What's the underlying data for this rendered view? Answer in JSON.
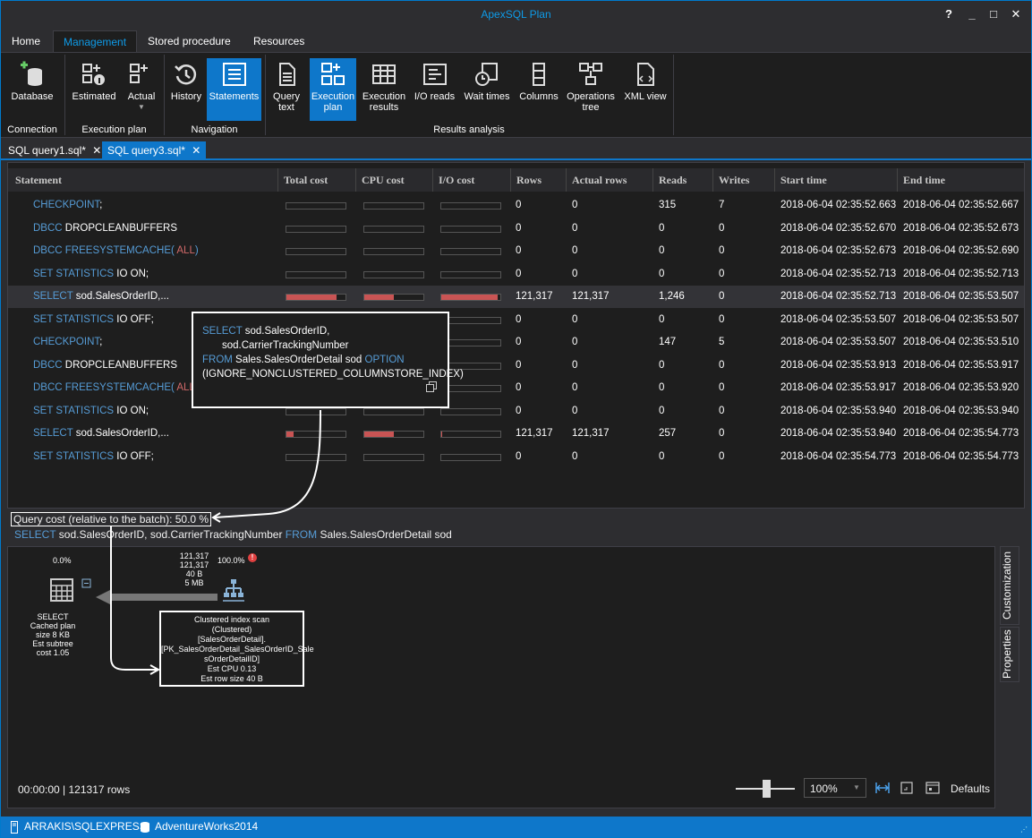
{
  "window": {
    "title": "ApexSQL Plan",
    "help": "?",
    "minimize": "_",
    "maximize": "□",
    "close": "✕"
  },
  "menu": [
    "Home",
    "Management",
    "Stored procedure",
    "Resources"
  ],
  "ribbon": {
    "connection": {
      "group": "Connection",
      "database": "Database"
    },
    "execution_plan": {
      "group": "Execution plan",
      "estimated": "Estimated",
      "actual": "Actual"
    },
    "navigation": {
      "group": "Navigation",
      "history": "History",
      "statements": "Statements"
    },
    "results": {
      "group": "Results analysis",
      "query_text": [
        "Query",
        "text"
      ],
      "execution_plan": [
        "Execution",
        "plan"
      ],
      "execution_results": [
        "Execution",
        "results"
      ],
      "io_reads": "I/O reads",
      "wait_times": "Wait times",
      "columns": "Columns",
      "operations_tree": [
        "Operations",
        "tree"
      ],
      "xml_view": "XML view"
    }
  },
  "doc_tabs": [
    {
      "label": "SQL query1.sql*",
      "close": "✕"
    },
    {
      "label": "SQL query3.sql*",
      "close": "✕"
    }
  ],
  "grid": {
    "headers": [
      "Statement",
      "Total cost",
      "CPU cost",
      "I/O cost",
      "Rows",
      "Actual rows",
      "Reads",
      "Writes",
      "Start time",
      "End time"
    ],
    "rows": [
      {
        "s1": "CHECKPOINT",
        "s2": ";",
        "s3": "",
        "s4": "",
        "tc": 0,
        "cc": 0,
        "ic": 0,
        "rows": "0",
        "actual": "0",
        "reads": "315",
        "writes": "7",
        "start": "2018-06-04 02:35:52.663",
        "end": "2018-06-04 02:35:52.667"
      },
      {
        "s1": "DBCC",
        "s2": " DROPCLEANBUFFERS",
        "s3": "",
        "s4": "",
        "tc": 0,
        "cc": 0,
        "ic": 0,
        "rows": "0",
        "actual": "0",
        "reads": "0",
        "writes": "0",
        "start": "2018-06-04 02:35:52.670",
        "end": "2018-06-04 02:35:52.673"
      },
      {
        "s1": "DBCC FREESYSTEMCACHE(",
        "s2": "",
        "s3": " ALL",
        "s4": ")",
        "tc": 0,
        "cc": 0,
        "ic": 0,
        "rows": "0",
        "actual": "0",
        "reads": "0",
        "writes": "0",
        "start": "2018-06-04 02:35:52.673",
        "end": "2018-06-04 02:35:52.690"
      },
      {
        "s1": "SET STATISTICS",
        "s2": " IO ",
        "s3": "",
        "s4": "ON;",
        "tc": 0,
        "cc": 0,
        "ic": 0,
        "rows": "0",
        "actual": "0",
        "reads": "0",
        "writes": "0",
        "start": "2018-06-04 02:35:52.713",
        "end": "2018-06-04 02:35:52.713"
      },
      {
        "s1": "SELECT",
        "s2": " sod.SalesOrderID,...",
        "s3": "",
        "s4": "",
        "tc": 0.85,
        "cc": 0.5,
        "ic": 0.95,
        "rows": "121,317",
        "actual": "121,317",
        "reads": "1,246",
        "writes": "0",
        "start": "2018-06-04 02:35:52.713",
        "end": "2018-06-04 02:35:53.507"
      },
      {
        "s1": "SET STATISTICS",
        "s2": " IO ",
        "s3": "",
        "s4": "OFF;",
        "tc": 0,
        "cc": 0,
        "ic": 0,
        "rows": "0",
        "actual": "0",
        "reads": "0",
        "writes": "0",
        "start": "2018-06-04 02:35:53.507",
        "end": "2018-06-04 02:35:53.507"
      },
      {
        "s1": "CHECKPOINT",
        "s2": ";",
        "s3": "",
        "s4": "",
        "tc": 0,
        "cc": 0,
        "ic": 0,
        "rows": "0",
        "actual": "0",
        "reads": "147",
        "writes": "5",
        "start": "2018-06-04 02:35:53.507",
        "end": "2018-06-04 02:35:53.510"
      },
      {
        "s1": "DBCC",
        "s2": " DROPCLEANBUFFERS",
        "s3": "",
        "s4": "",
        "tc": 0,
        "cc": 0,
        "ic": 0,
        "rows": "0",
        "actual": "0",
        "reads": "0",
        "writes": "0",
        "start": "2018-06-04 02:35:53.913",
        "end": "2018-06-04 02:35:53.917"
      },
      {
        "s1": "DBCC FREESYSTEMCACHE(",
        "s2": "",
        "s3": " ALL",
        "s4": ")",
        "tc": 0,
        "cc": 0,
        "ic": 0,
        "rows": "0",
        "actual": "0",
        "reads": "0",
        "writes": "0",
        "start": "2018-06-04 02:35:53.917",
        "end": "2018-06-04 02:35:53.920"
      },
      {
        "s1": "SET STATISTICS",
        "s2": " IO ",
        "s3": "",
        "s4": "ON;",
        "tc": 0,
        "cc": 0,
        "ic": 0,
        "rows": "0",
        "actual": "0",
        "reads": "0",
        "writes": "0",
        "start": "2018-06-04 02:35:53.940",
        "end": "2018-06-04 02:35:53.940"
      },
      {
        "s1": "SELECT",
        "s2": " sod.SalesOrderID,...",
        "s3": "",
        "s4": "",
        "tc": 0.12,
        "cc": 0.5,
        "ic": 0.02,
        "rows": "121,317",
        "actual": "121,317",
        "reads": "257",
        "writes": "0",
        "start": "2018-06-04 02:35:53.940",
        "end": "2018-06-04 02:35:54.773"
      },
      {
        "s1": "SET STATISTICS",
        "s2": " IO ",
        "s3": "",
        "s4": "OFF;",
        "tc": 0,
        "cc": 0,
        "ic": 0,
        "rows": "0",
        "actual": "0",
        "reads": "0",
        "writes": "0",
        "start": "2018-06-04 02:35:54.773",
        "end": "2018-06-04 02:35:54.773"
      }
    ]
  },
  "tooltip": {
    "l1a": "SELECT",
    "l1b": " sod.SalesOrderID,",
    "l2": "sod.CarrierTrackingNumber",
    "l3a": "FROM",
    "l3b": " Sales.SalesOrderDetail sod ",
    "l3c": "OPTION",
    "l4": "(IGNORE_NONCLUSTERED_COLUMNSTORE_INDEX)"
  },
  "query_cost": "Query cost (relative to the batch):  50.0 %",
  "query_sql": {
    "a": "SELECT",
    "b": " sod.SalesOrderID, sod.CarrierTrackingNumber ",
    "c": "FROM",
    "d": " Sales.SalesOrderDetail sod"
  },
  "plan": {
    "select_pct": "0.0%",
    "select_label": [
      "SELECT",
      "Cached plan size  8 KB",
      "Est subtree cost  1.05"
    ],
    "scan_stats": [
      "121,317",
      "121,317",
      "40 B",
      "5 MB"
    ],
    "scan_pct": "100.0%",
    "node_box": [
      "Clustered index scan",
      "(Clustered)",
      "[SalesOrderDetail].",
      "[PK_SalesOrderDetail_SalesOrderID_Sale",
      "sOrderDetailID]",
      "Est CPU  0.13",
      "Est row size  40 B"
    ],
    "side_tabs": [
      "Customization",
      "Properties"
    ],
    "footer": "00:00:00 | 121317 rows",
    "zoom": "100%",
    "defaults": "Defaults"
  },
  "status": {
    "server": "ARRAKIS\\SQLEXPRESS",
    "database": "AdventureWorks2014"
  },
  "colors": {
    "accent": "#0e77ca",
    "bar": "#c95454",
    "keyword": "#569cd6",
    "function": "#d16969"
  }
}
